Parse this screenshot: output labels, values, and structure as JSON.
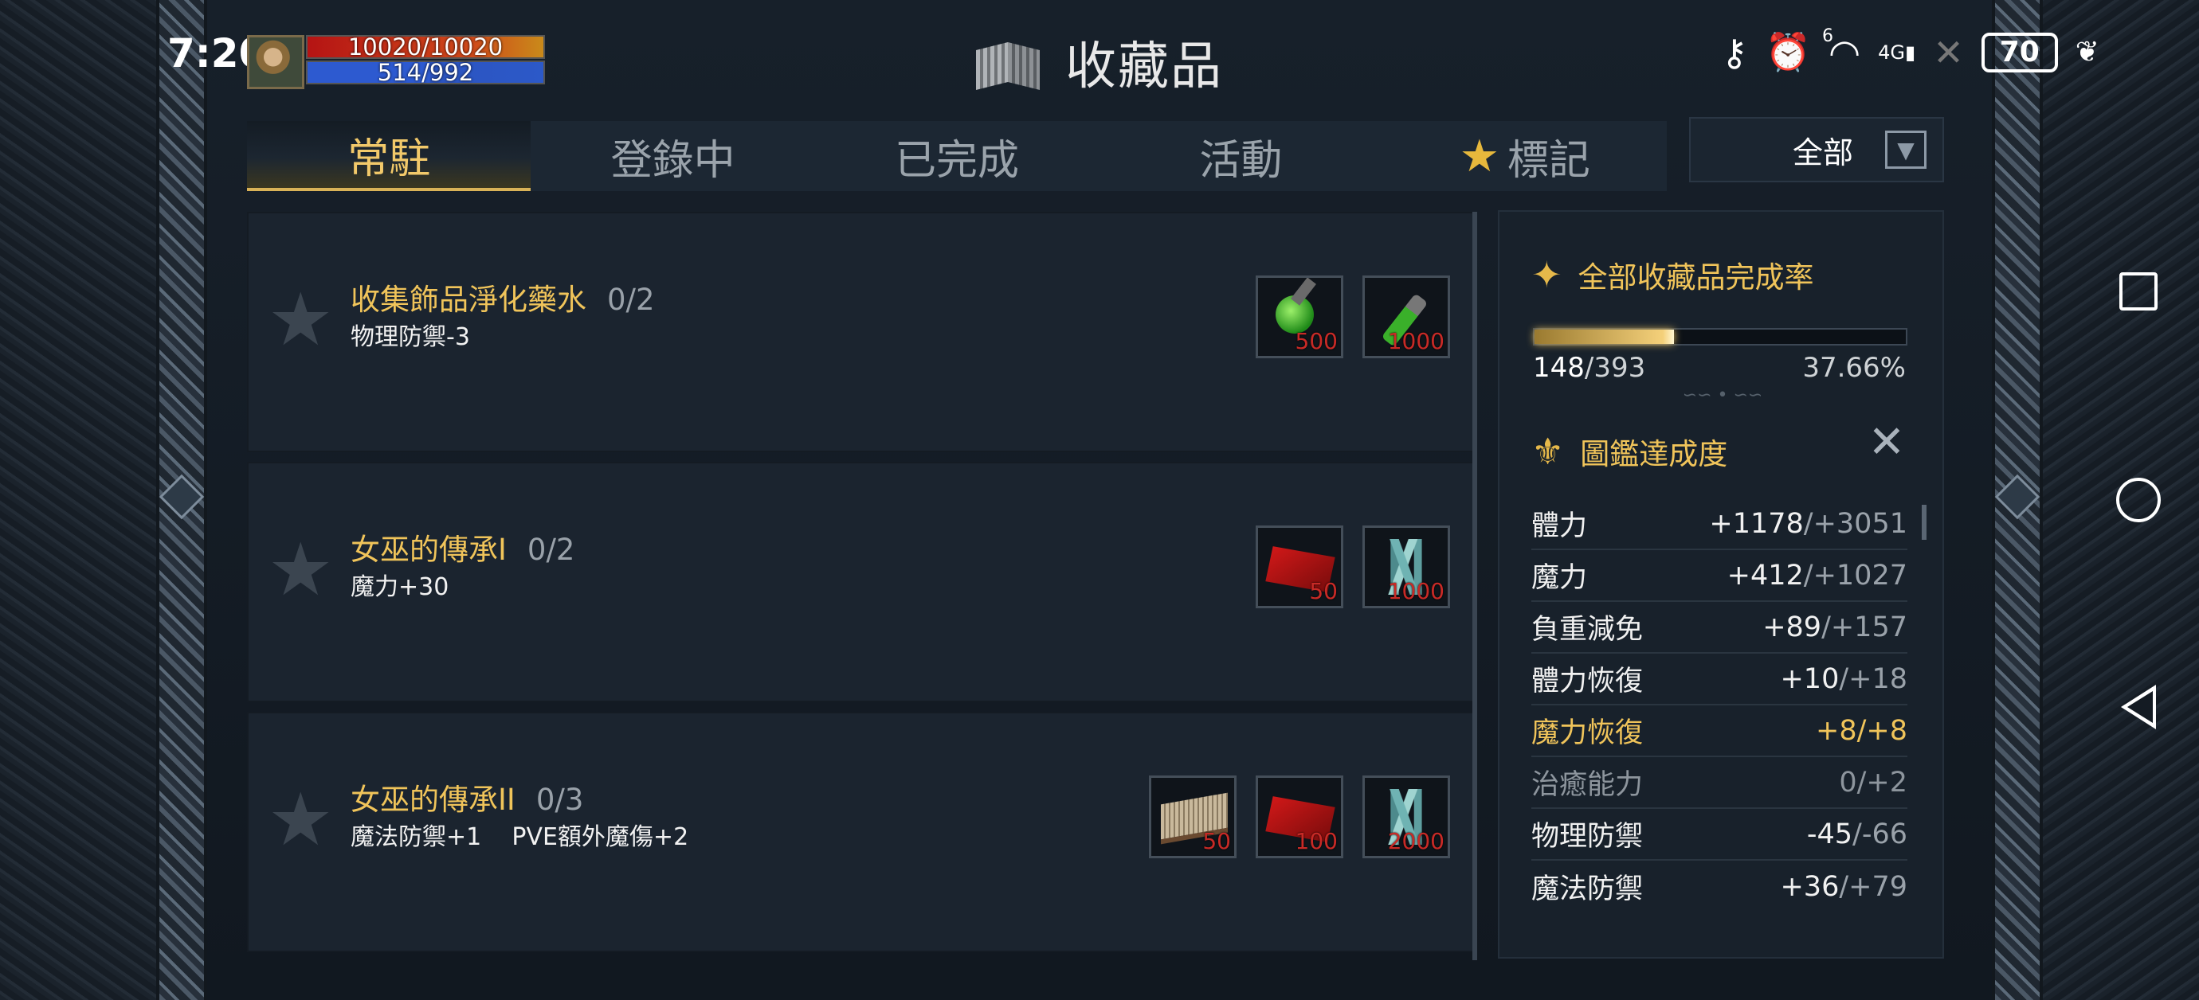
{
  "status_bar": {
    "time": "7:20",
    "hp": "10020/10020",
    "mp": "514/992",
    "battery": "70",
    "network": "4G",
    "wifi_badge": "6"
  },
  "header": {
    "title": "收藏品"
  },
  "tabs": [
    {
      "label": "常駐",
      "active": true
    },
    {
      "label": "登錄中",
      "active": false
    },
    {
      "label": "已完成",
      "active": false
    },
    {
      "label": "活動",
      "active": false
    },
    {
      "label": "標記",
      "active": false,
      "icon": "star-icon"
    }
  ],
  "filter": {
    "label": "全部"
  },
  "collections": [
    {
      "name": "收集飾品淨化藥水",
      "count": "0/2",
      "effect": "物理防禦-3",
      "materials": [
        {
          "icon": "green-potion-icon",
          "qty": "500"
        },
        {
          "icon": "green-vial-icon",
          "qty": "1000"
        }
      ]
    },
    {
      "name": "女巫的傳承I",
      "count": "0/2",
      "effect": "魔力+30",
      "materials": [
        {
          "icon": "red-book-icon",
          "qty": "50"
        },
        {
          "icon": "crystal-icon",
          "qty": "1000"
        }
      ]
    },
    {
      "name": "女巫的傳承II",
      "count": "0/3",
      "effect": "魔法防禦+1    PVE額外魔傷+2",
      "materials": [
        {
          "icon": "old-book-icon",
          "qty": "50"
        },
        {
          "icon": "red-book-icon",
          "qty": "100"
        },
        {
          "icon": "crystal-icon",
          "qty": "2000"
        }
      ]
    }
  ],
  "completion": {
    "title": "全部收藏品完成率",
    "done": "148",
    "total": "/393",
    "percent": "37.66%",
    "progress_fraction": 0.3766
  },
  "codex": {
    "title": "圖鑑達成度",
    "stats": [
      {
        "name": "體力",
        "current": "+1178",
        "max": "/+3051",
        "style": "normal"
      },
      {
        "name": "魔力",
        "current": "+412",
        "max": "/+1027",
        "style": "normal"
      },
      {
        "name": "負重減免",
        "current": "+89",
        "max": "/+157",
        "style": "normal"
      },
      {
        "name": "體力恢復",
        "current": "+10",
        "max": "/+18",
        "style": "normal"
      },
      {
        "name": "魔力恢復",
        "current": "+8",
        "max": "/+8",
        "style": "highlight"
      },
      {
        "name": "治癒能力",
        "current": "0",
        "max": "/+2",
        "style": "dim"
      },
      {
        "name": "物理防禦",
        "current": "-45",
        "max": "/-66",
        "style": "normal"
      },
      {
        "name": "魔法防禦",
        "current": "+36",
        "max": "/+79",
        "style": "normal"
      }
    ]
  },
  "colors": {
    "accent_gold": "#f0c45a",
    "qty_red": "#c82a26",
    "panel_bg": "#18212b"
  }
}
